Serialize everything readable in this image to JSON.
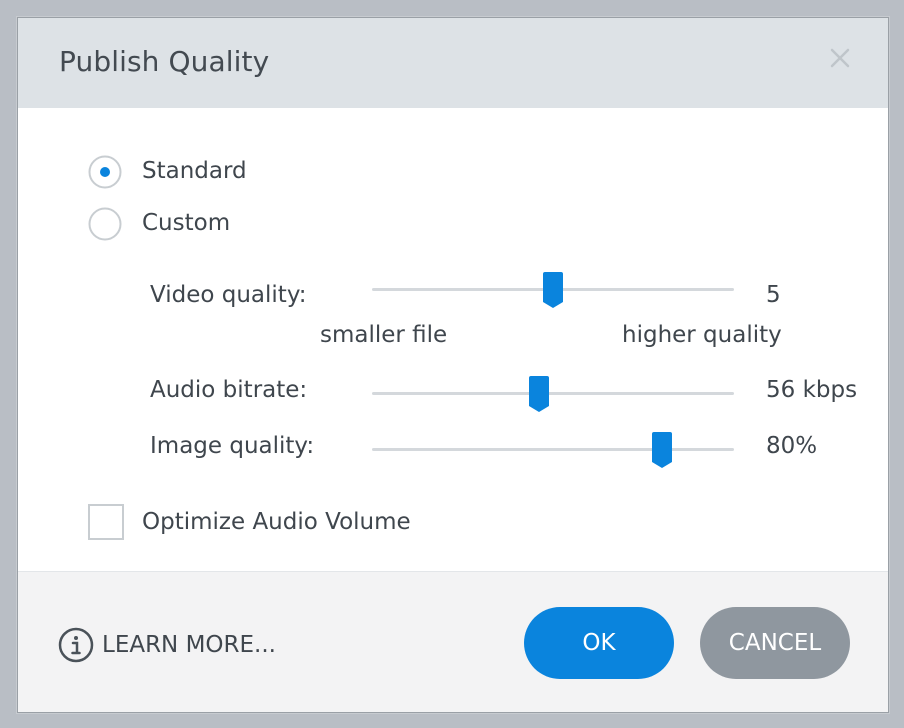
{
  "dialog": {
    "title": "Publish Quality",
    "close_icon": "close-icon"
  },
  "quality_mode": {
    "options": [
      {
        "label": "Standard",
        "selected": true
      },
      {
        "label": "Custom",
        "selected": false
      }
    ]
  },
  "sliders": {
    "video": {
      "label": "Video quality:",
      "value_text": "5",
      "level": 0.5,
      "min_caption": "smaller file",
      "max_caption": "higher quality"
    },
    "audio": {
      "label": "Audio bitrate:",
      "value_text": "56 kbps",
      "level": 0.46
    },
    "image": {
      "label": "Image quality:",
      "value_text": "80%",
      "level": 0.8
    }
  },
  "optimize_audio": {
    "label": "Optimize Audio Volume",
    "checked": false
  },
  "footer": {
    "learn_more_label": "LEARN MORE...",
    "learn_more_icon": "info-icon",
    "ok_label": "OK",
    "cancel_label": "CANCEL"
  },
  "colors": {
    "accent": "#0a84dd",
    "cancel": "#8f979f",
    "header_bg": "#dde2e6",
    "footer_bg": "#f3f3f4"
  }
}
